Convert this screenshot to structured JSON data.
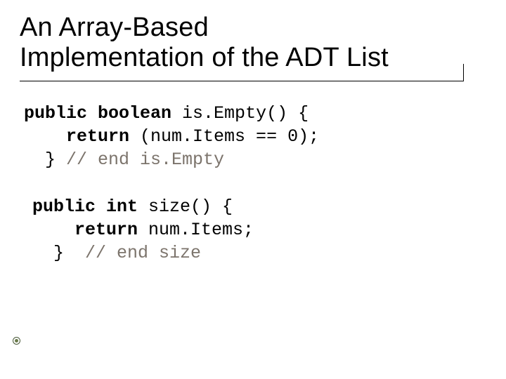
{
  "title_line1": "An Array-Based",
  "title_line2": "Implementation of the ADT List",
  "code1": {
    "kw1": "public boolean",
    "l1_rest": " is.Empty() {",
    "kw2": "return",
    "l2_rest": " (num.Items == 0);",
    "l3a": "  } ",
    "l3_comment": "// end is.Empty"
  },
  "code2": {
    "kw1": "public int",
    "l1_rest": " size() {",
    "kw2": "return",
    "l2_rest": " num.Items;",
    "l3a": "  }  ",
    "l3_comment": "// end size"
  }
}
